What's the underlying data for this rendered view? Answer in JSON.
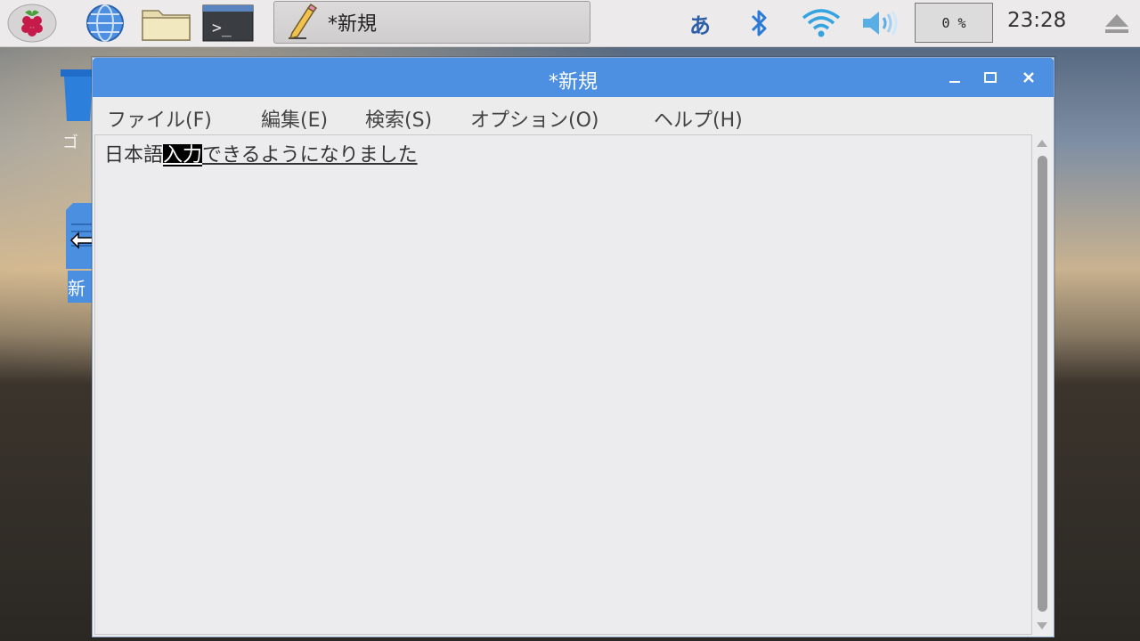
{
  "taskbar": {
    "launchers": [
      {
        "icon": "raspberry-menu-icon"
      },
      {
        "icon": "web-browser-icon"
      },
      {
        "icon": "file-manager-icon"
      },
      {
        "icon": "terminal-icon"
      }
    ],
    "task": {
      "icon": "text-editor-icon",
      "title": "*新規"
    },
    "tray": {
      "ime": "あ",
      "bluetooth_icon": "bluetooth-icon",
      "wifi_icon": "wifi-icon",
      "volume_icon": "volume-icon",
      "cpu": "0 %",
      "clock": "23:28",
      "eject_icon": "eject-icon"
    }
  },
  "desktop": {
    "trash_label": "ゴ",
    "doc_label": "新"
  },
  "window": {
    "title": "*新規",
    "menu": [
      "ファイル(F)",
      "編集(E)",
      "検索(S)",
      "オプション(O)",
      "ヘルプ(H)"
    ],
    "text_before": "日本語",
    "text_selected": "入力",
    "text_after": "できるようになりました"
  },
  "colors": {
    "titlebar": "#4d8fe1",
    "accent": "#2f5fa8"
  }
}
